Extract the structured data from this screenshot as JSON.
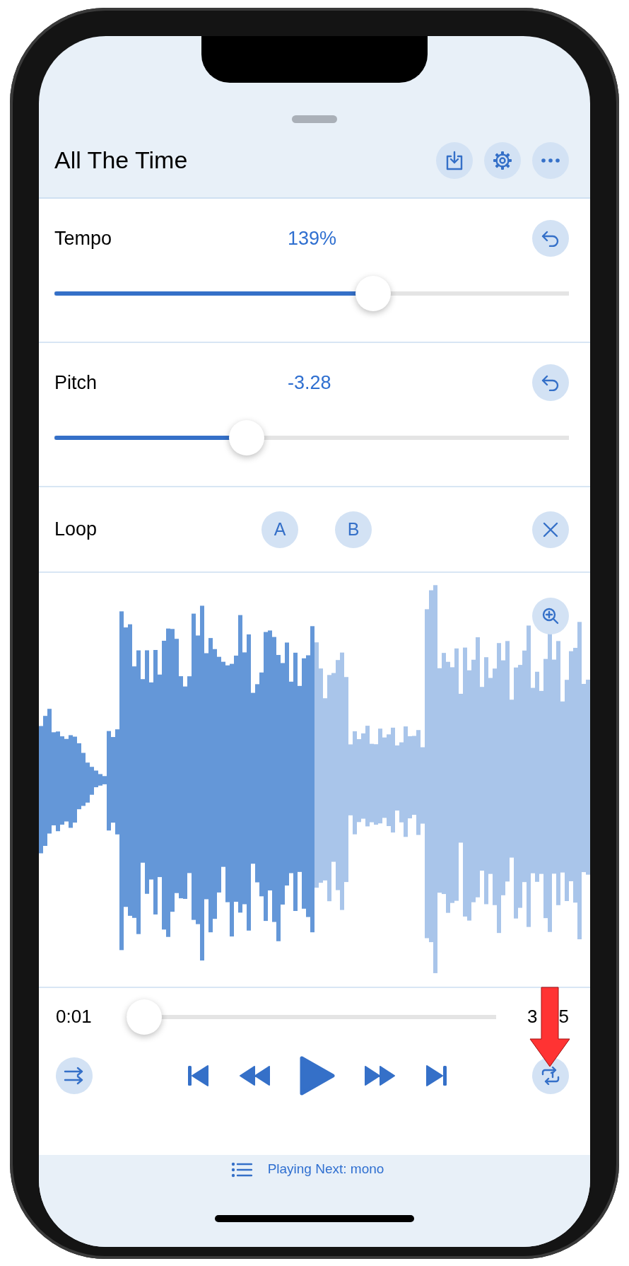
{
  "title": "All The Time",
  "header_buttons": [
    {
      "kind": "download"
    },
    {
      "kind": "settings"
    },
    {
      "kind": "more"
    }
  ],
  "adjustments": [
    {
      "label": "Tempo",
      "value": "139%",
      "level": 0.62
    },
    {
      "label": "Pitch",
      "value": "-3.28",
      "level": 0.373
    }
  ],
  "loop": {
    "label": "Loop",
    "markers": [
      "A",
      "B"
    ]
  },
  "playback": {
    "current_time": "0:01",
    "end_time_parts": [
      "3",
      "5"
    ],
    "level": 0.0
  },
  "annotation": {
    "kind": "arrow"
  },
  "up_next": "Playing Next: mono"
}
